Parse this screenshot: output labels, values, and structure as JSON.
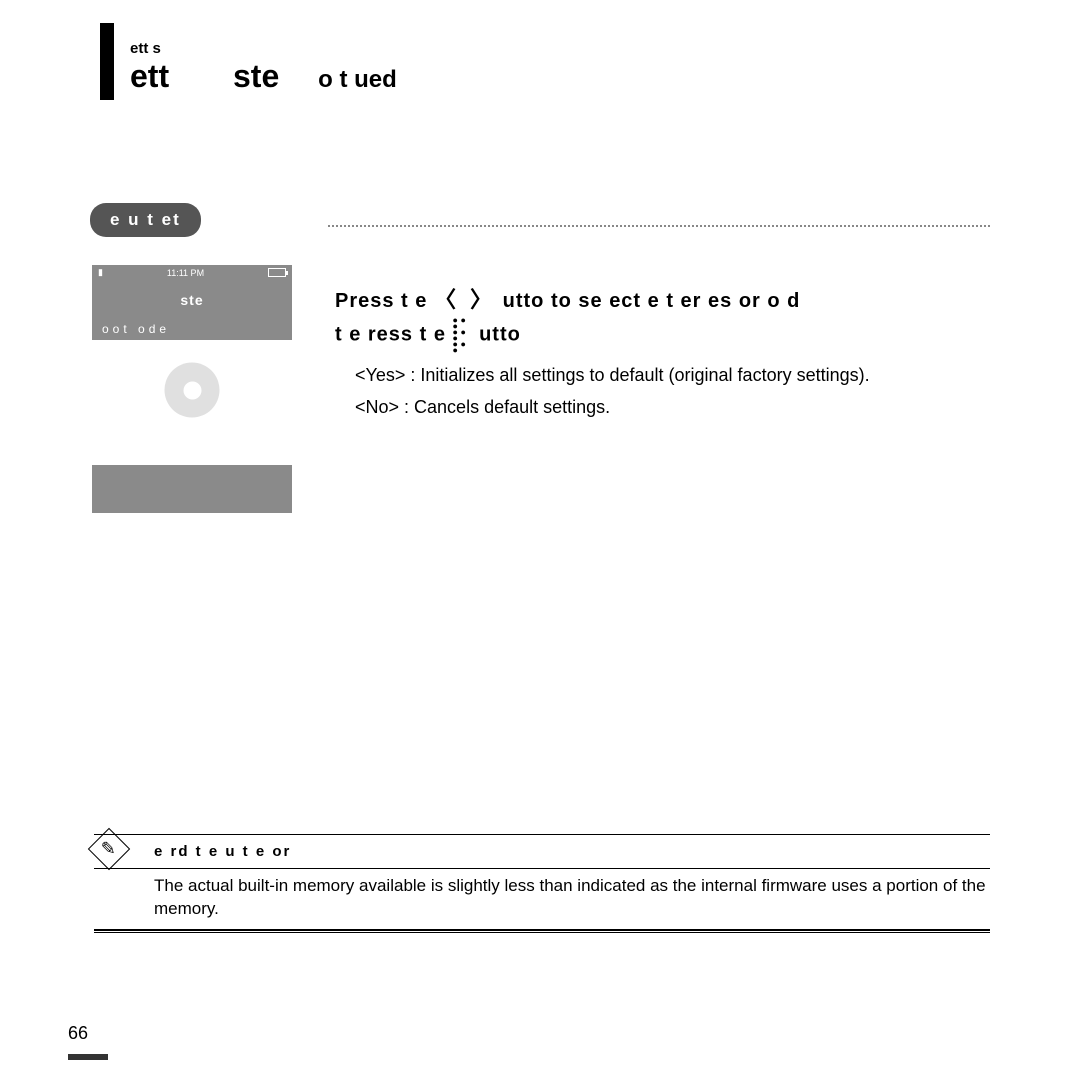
{
  "breadcrumb": "ett     s",
  "title_a": "ett",
  "title_b": "ste",
  "title_c": "o  t   ued",
  "section_label": "e    u  t    et",
  "device": {
    "time": "11:11 PM",
    "screen_title": "ste",
    "option1": "oot     ode"
  },
  "instruction_line1_pre": "Press t  e  ",
  "instruction_arrows": "〈  〉",
  "instruction_line1_post": "    utto   to se  ect e t  er      es   or       o       d",
  "instruction_line2_pre": "t  e       ress t  e   ",
  "instruction_line2_post": "   utto",
  "desc_yes": "<Yes> :  Initializes all settings to default (original factory settings).",
  "desc_no": "<No> : Cancels default settings.",
  "note_title": "e   rd      t  e  u   t        e  or",
  "note_body": "The actual built-in memory available is slightly less than indicated as the internal firmware uses a portion of the memory.",
  "page_number": "66"
}
